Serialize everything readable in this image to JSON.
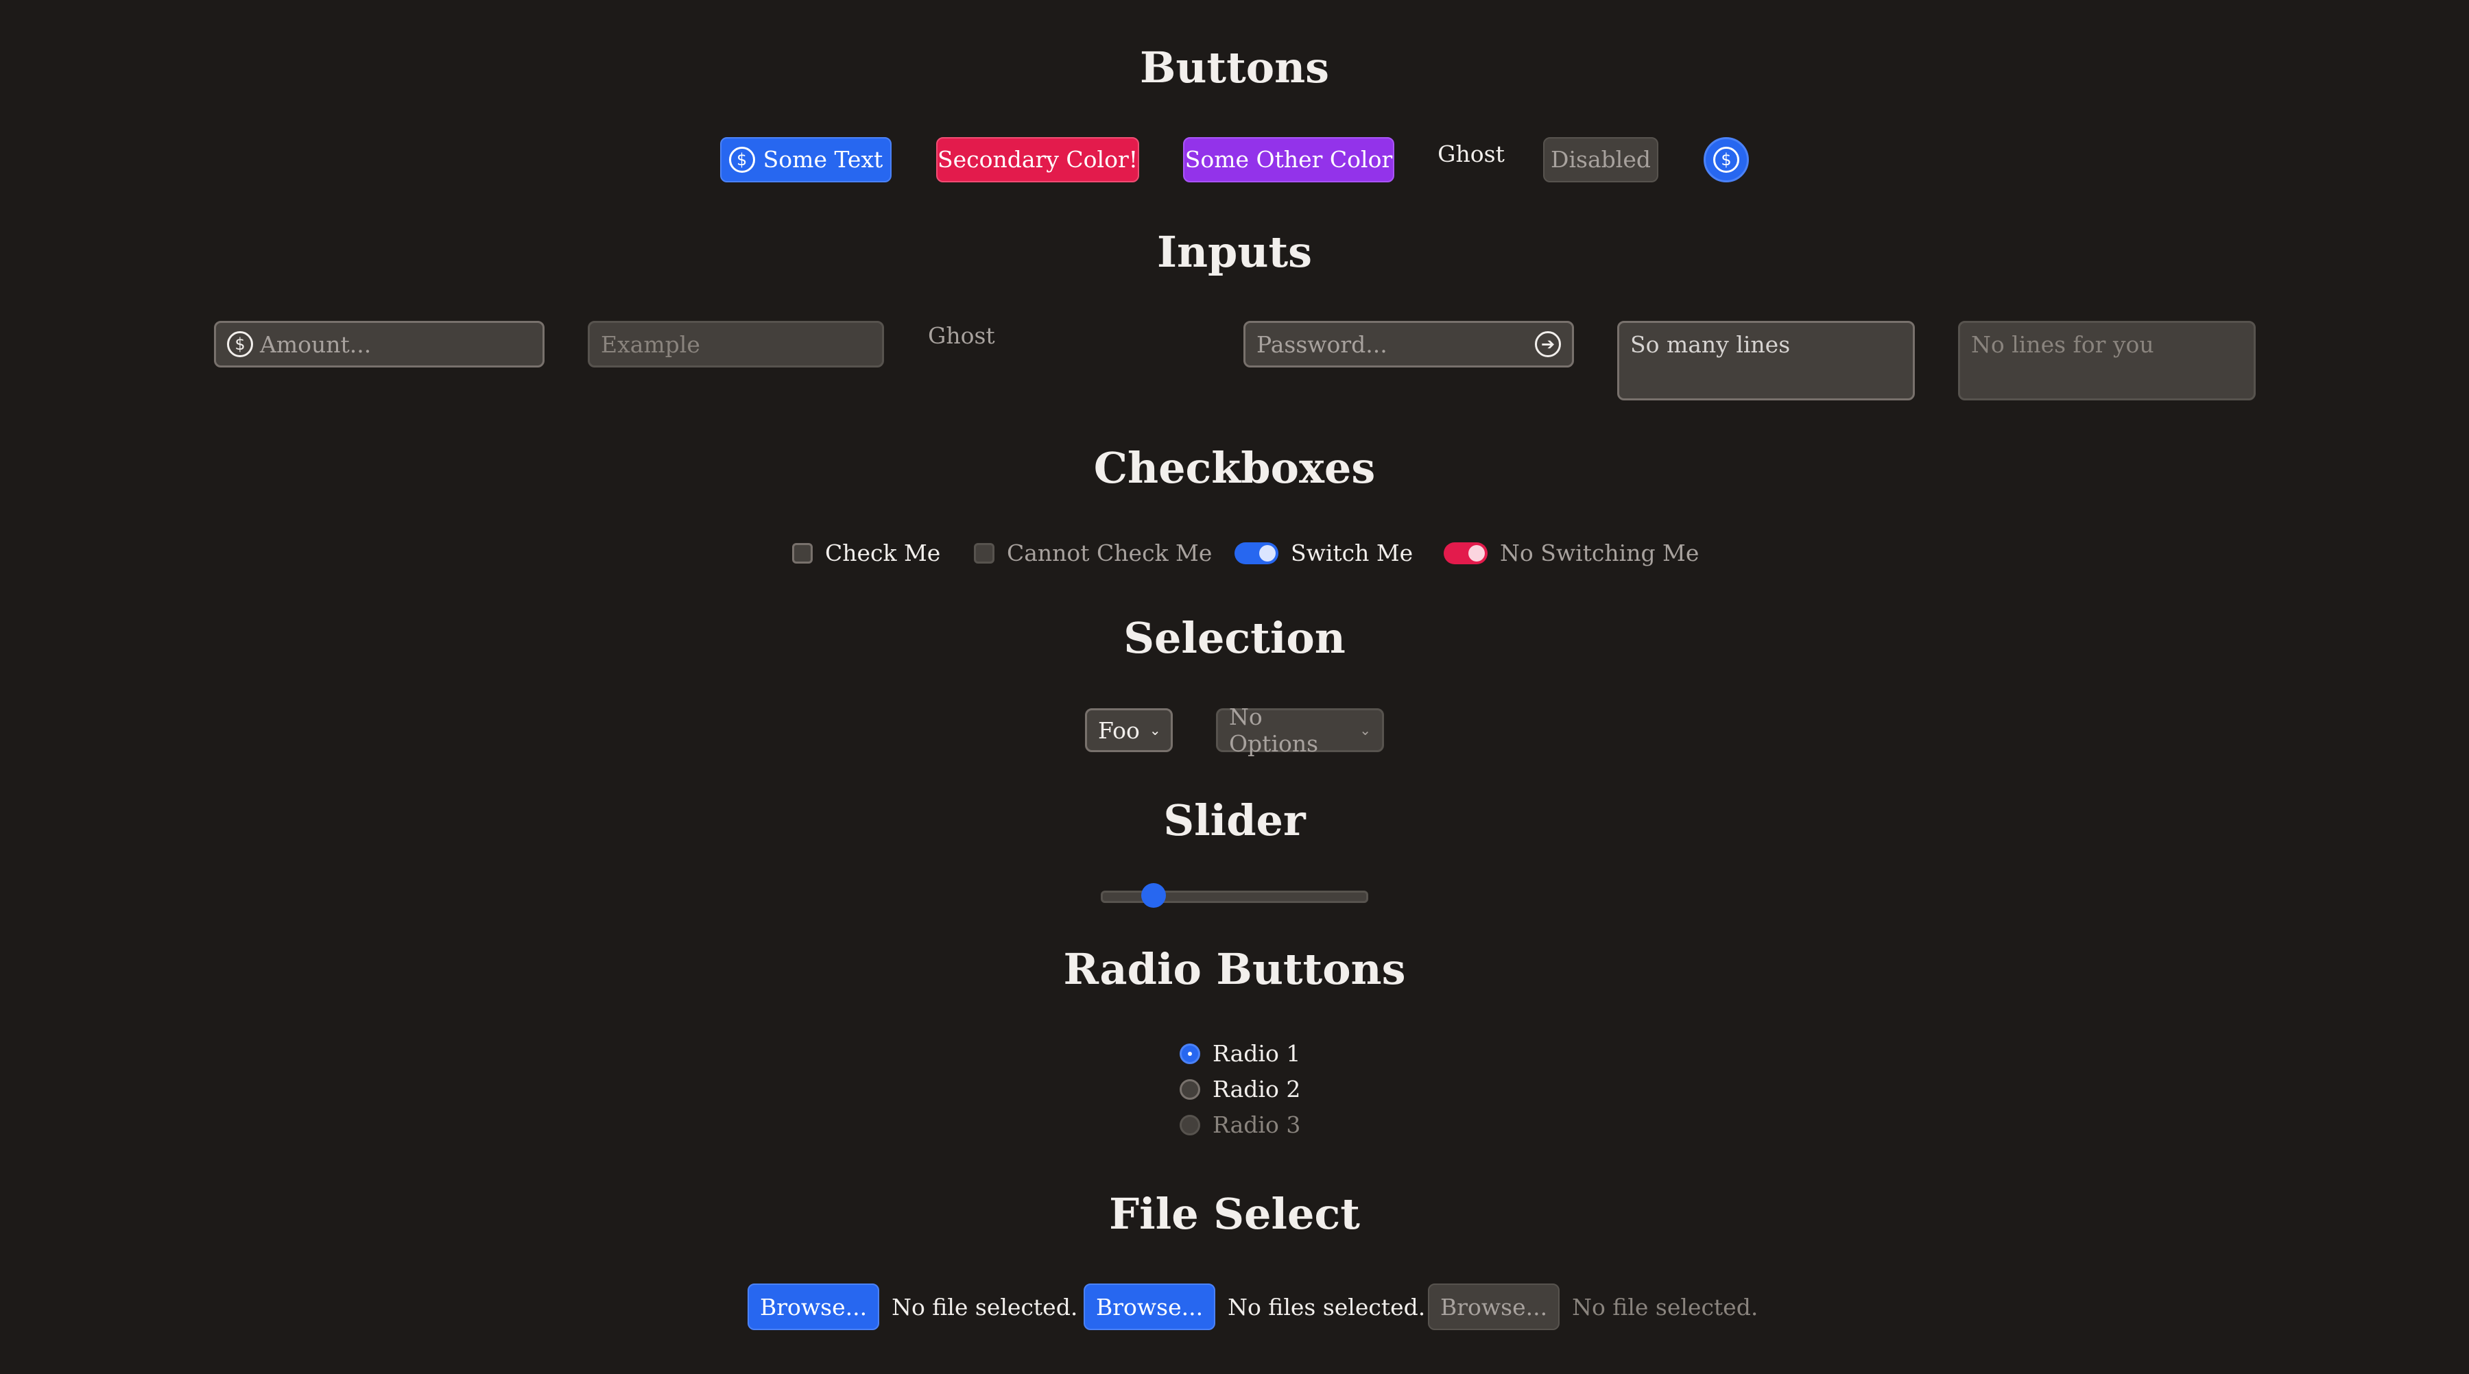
{
  "sections": {
    "buttons": "Buttons",
    "inputs": "Inputs",
    "checkboxes": "Checkboxes",
    "selection": "Selection",
    "slider": "Slider",
    "radio": "Radio Buttons",
    "file": "File Select"
  },
  "buttons": {
    "primary": "Some Text",
    "secondary": "Secondary Color!",
    "other": "Some Other Color",
    "ghost": "Ghost",
    "disabled": "Disabled",
    "icon_primary": "dollar-circle-icon",
    "icon_round": "dollar-circle-icon"
  },
  "inputs": {
    "amount_placeholder": "Amount...",
    "amount_icon": "dollar-circle-icon",
    "example_placeholder": "Example",
    "ghost_placeholder": "Ghost",
    "password_placeholder": "Password...",
    "password_icon": "arrow-right-circle-icon",
    "textarea_value": "So many lines",
    "textarea_disabled_placeholder": "No lines for you"
  },
  "checkboxes": {
    "check_me": "Check Me",
    "cannot_check_me": "Cannot Check Me",
    "switch_me": "Switch Me",
    "no_switching_me": "No Switching Me",
    "switch_me_on": true,
    "no_switching_me_on": true
  },
  "selection": {
    "foo": "Foo",
    "no_options": "No Options"
  },
  "slider": {
    "value_fraction": 0.2
  },
  "radio": {
    "items": [
      "Radio 1",
      "Radio 2",
      "Radio 3"
    ],
    "selected_index": 0
  },
  "file": {
    "browse_label": "Browse...",
    "single_status": "No file selected.",
    "multi_status": "No files selected.",
    "disabled_status": "No file selected."
  },
  "colors": {
    "background": "#1d1a18",
    "primary": "#2767f0",
    "secondary": "#e31b4c",
    "other": "#9333ea",
    "surface": "#44403c"
  }
}
